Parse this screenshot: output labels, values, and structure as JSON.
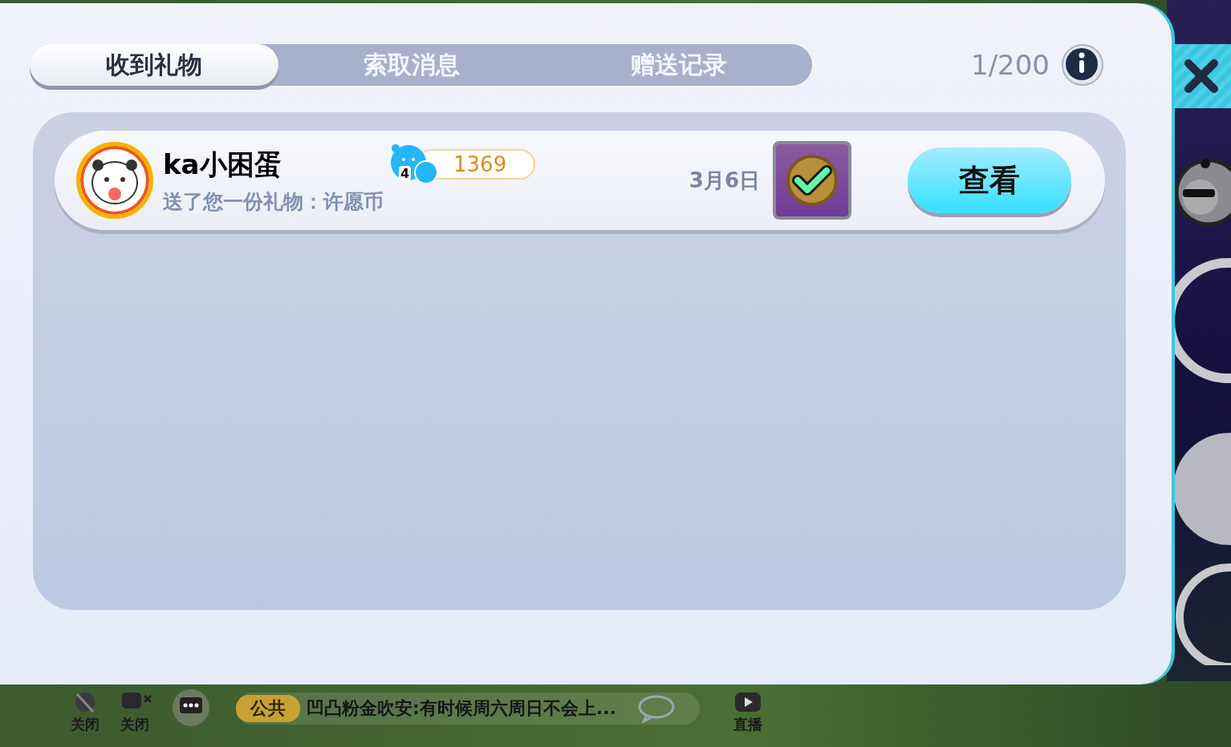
{
  "tabs": [
    {
      "label": "收到礼物",
      "selected": true
    },
    {
      "label": "索取消息",
      "selected": false
    },
    {
      "label": "赠送记录",
      "selected": false
    }
  ],
  "counter": "1/200",
  "gifts": [
    {
      "name": "ka小困蛋",
      "message": "送了您一份礼物：许愿币",
      "badge_level": "4",
      "score": "1369",
      "date": "3月6日",
      "action": "查看"
    }
  ],
  "bottom_bar": {
    "toggles": [
      {
        "label": "关闭"
      },
      {
        "label": "关闭"
      }
    ],
    "channel": "公共",
    "chat": "凹凸粉金吹安:有时候周六周日不会上...",
    "live": "直播"
  }
}
